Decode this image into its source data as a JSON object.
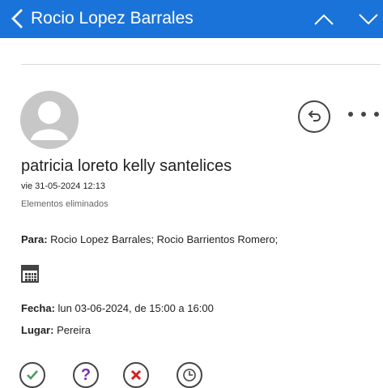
{
  "header": {
    "title": "Rocio Lopez Barrales",
    "back_icon": "chevron-left-icon",
    "up_icon": "chevron-up-icon",
    "down_icon": "chevron-down-icon",
    "accent": "#1a73d9"
  },
  "message": {
    "sender": "patricia loreto kelly santelices",
    "date": "vie 31-05-2024 12:13",
    "folder": "Elementos eliminados",
    "to_label": "Para:",
    "to_value": "Rocio Lopez Barrales; Rocio Barrientos Romero;",
    "fecha_label": "Fecha:",
    "fecha_value": "lun 03-06-2024, de 15:00 a 16:00",
    "lugar_label": "Lugar:",
    "lugar_value": "Pereira"
  },
  "icons": {
    "avatar": "person-avatar-icon",
    "reply": "reply-icon",
    "more": "more-options-icon",
    "calendar": "calendar-icon",
    "accept": "accept-icon",
    "tentative": "tentative-icon",
    "decline": "decline-icon",
    "propose": "propose-time-icon"
  },
  "response_colors": {
    "accept": "#4a9a58",
    "tentative": "#7a2fb6",
    "decline": "#d71e1e"
  }
}
